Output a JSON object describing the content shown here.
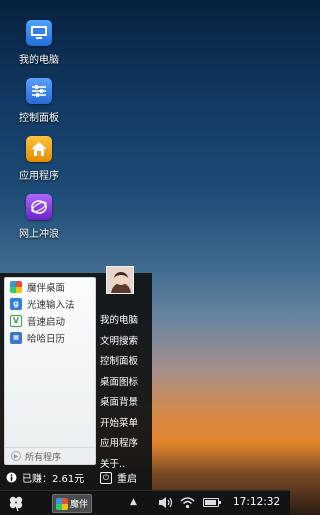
{
  "desktop": {
    "icons": [
      {
        "label": "我的电脑"
      },
      {
        "label": "控制面板"
      },
      {
        "label": "应用程序"
      },
      {
        "label": "网上冲浪"
      }
    ]
  },
  "start_menu": {
    "apps": [
      {
        "label": "魔伴桌面",
        "icon": "mobi-desktop-icon"
      },
      {
        "label": "光速输入法",
        "icon": "input-method-icon"
      },
      {
        "label": "音速启动",
        "icon": "launcher-icon"
      },
      {
        "label": "哈哈日历",
        "icon": "calendar-icon"
      }
    ],
    "all_programs": "所有程序",
    "links": [
      {
        "label": "我的电脑"
      },
      {
        "label": "文明搜索"
      },
      {
        "label": "控制面板"
      },
      {
        "label": "桌面图标"
      },
      {
        "label": "桌面背景"
      },
      {
        "label": "开始菜单"
      },
      {
        "label": "应用程序"
      },
      {
        "label": "关于.."
      }
    ],
    "earned_text": "已赚：2.61元",
    "restart_label": "重启"
  },
  "taskbar": {
    "task_label": "魔伴",
    "clock": "17:12:32"
  },
  "colors": {
    "computer_tile": "#2f80ea",
    "control_panel_tile": "#3b7de0",
    "apps_tile": "#f2a20f",
    "browser_tile": "#8a3fd8"
  }
}
